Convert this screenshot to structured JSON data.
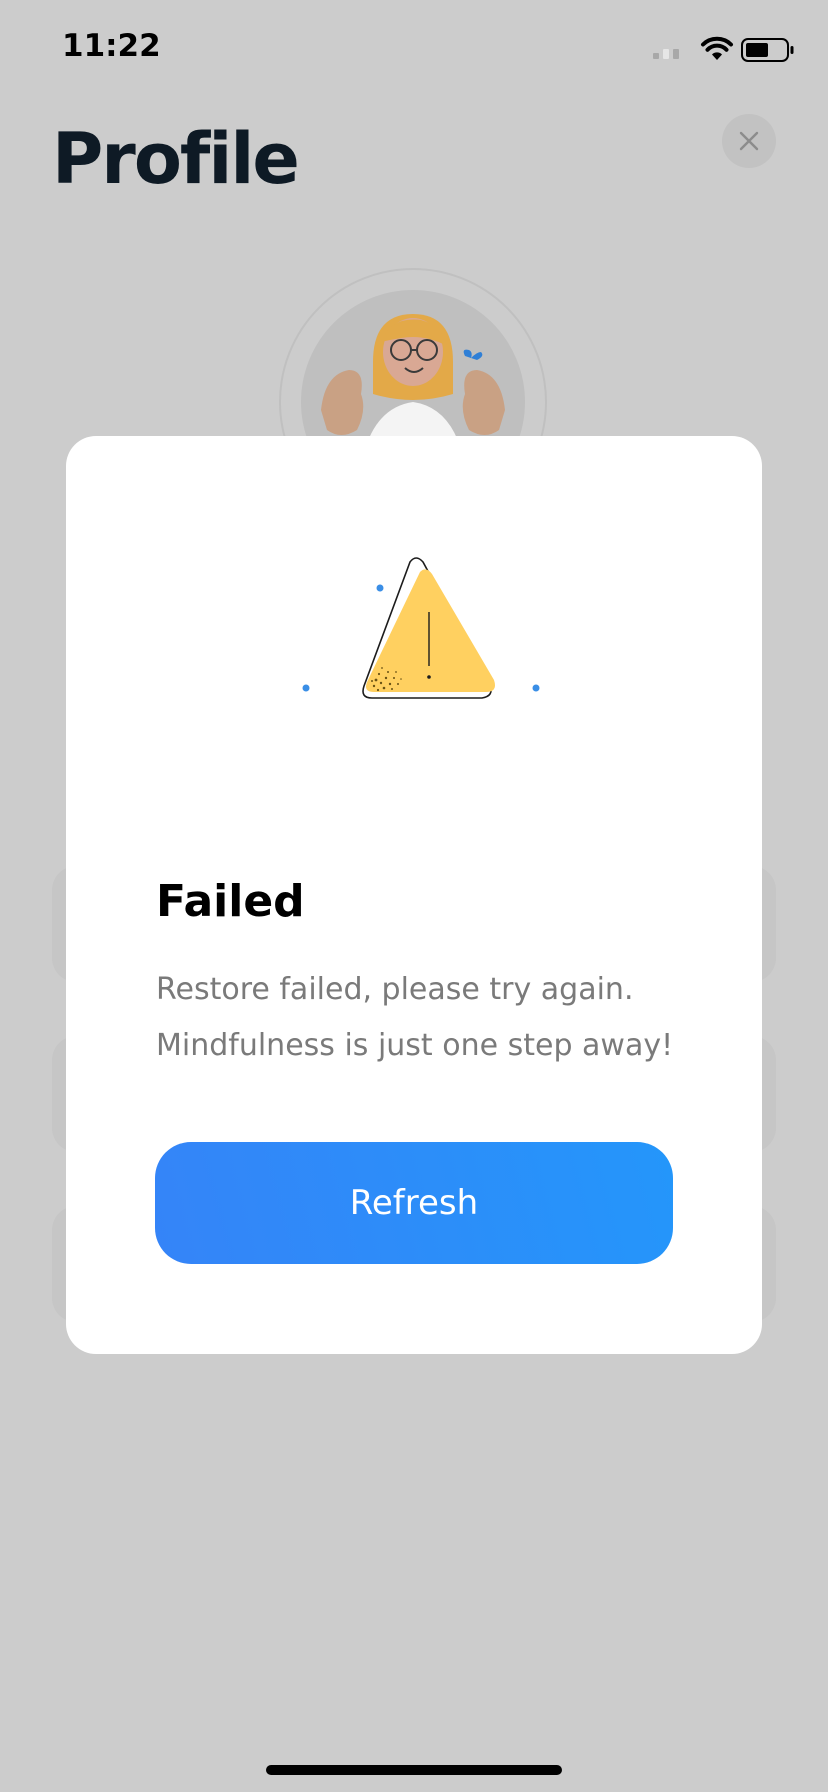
{
  "status_bar": {
    "time": "11:22"
  },
  "page": {
    "title": "Profile"
  },
  "modal": {
    "title": "Failed",
    "message_line_1": "Restore failed, please try again.",
    "message_line_2": "Mindfulness is just one step away!",
    "button_label": "Refresh"
  },
  "icons": {
    "signal": "signal-icon",
    "wifi": "wifi-icon",
    "battery": "battery-icon",
    "close": "close-icon",
    "warning": "warning-triangle-icon"
  },
  "colors": {
    "overlay_background": "#cccccc",
    "modal_background": "#ffffff",
    "button_gradient_start": "#3584f8",
    "button_gradient_end": "#2496fa",
    "warning_yellow": "#ffd060",
    "accent_dot_blue": "#3a8ee6",
    "title_dark": "#0e1a25"
  }
}
